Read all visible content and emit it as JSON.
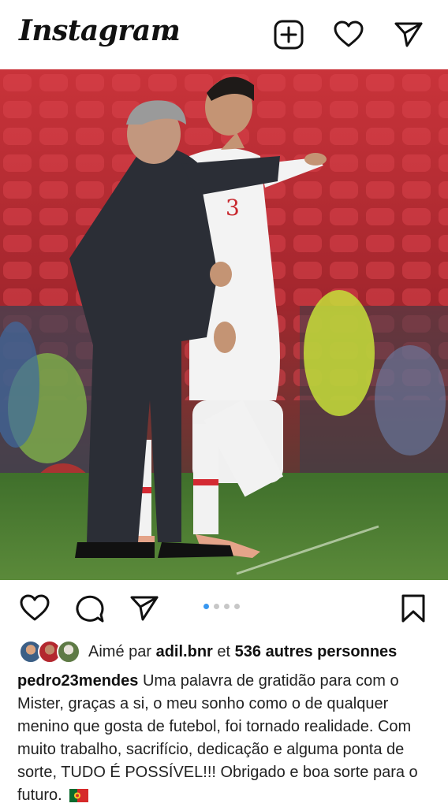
{
  "header": {
    "logo": "Instagram",
    "icons": [
      "chevron-down-icon",
      "new-post-icon",
      "heart-icon",
      "direct-message-icon"
    ]
  },
  "post": {
    "image": {
      "description_colors": {
        "stands": "#b8252c",
        "grass": "#4f7f33",
        "suit": "#2b2e36",
        "kit": "#f4f4f4"
      },
      "jersey_number": "3"
    },
    "carousel": {
      "total": 4,
      "active_index": 0
    },
    "likes": {
      "prefix": "Aimé par",
      "user": "adil.bnr",
      "connector": "et",
      "others": "536 autres personnes"
    },
    "caption": {
      "username": "pedro23mendes",
      "text": "Uma palavra de gratidão para com o Mister, graças a si, o meu sonho como o de qualquer menino que gosta de futebol, foi tornado realidade. Com muito trabalho, sacrifício, dedicação e alguma ponta de sorte, TUDO É POSSÍVEL!!! Obrigado e boa sorte para o futuro."
    }
  },
  "colors": {
    "accent": "#3897f0",
    "text": "#111111",
    "dot_inactive": "#c7c7c7"
  }
}
